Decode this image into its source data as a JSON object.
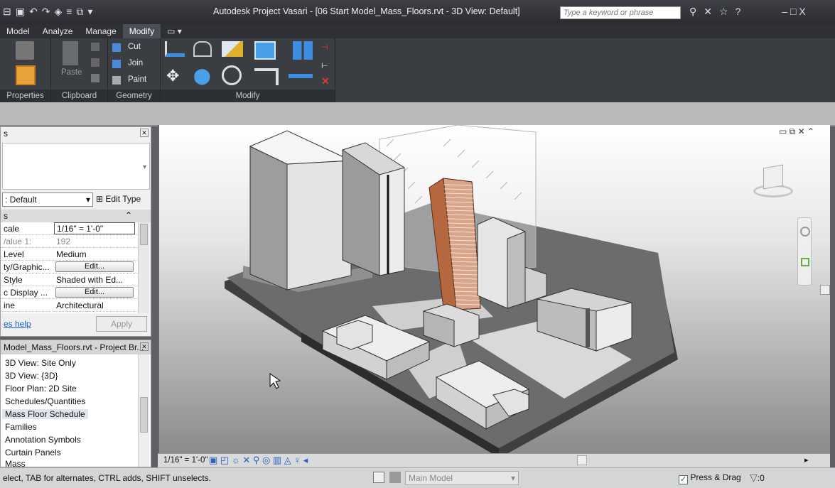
{
  "titlebar": {
    "title": "Autodesk Project Vasari - [06 Start Model_Mass_Floors.rvt - 3D View: Default]",
    "search_placeholder": "Type a keyword or phrase",
    "window_controls": "– □ X"
  },
  "ribbon_tabs": [
    "Model",
    "Analyze",
    "Manage",
    "Modify"
  ],
  "active_tab": "Modify",
  "ribbon": {
    "clipboard": {
      "paste": "Paste"
    },
    "geometry": {
      "cut": "Cut",
      "join": "Join",
      "paint": "Paint"
    },
    "panel_labels": {
      "properties": "Properties",
      "clipboard": "Clipboard",
      "geometry": "Geometry",
      "modify": "Modify"
    }
  },
  "properties": {
    "type_selector": ": Default",
    "edit_type": "Edit Type",
    "section_header": "s",
    "rows": [
      {
        "label": "cale",
        "value": "1/16\" = 1'-0\""
      },
      {
        "label": "/alue  1:",
        "value": "192"
      },
      {
        "label": "Level",
        "value": "Medium"
      },
      {
        "label": "ty/Graphic...",
        "value": "Edit..."
      },
      {
        "label": "Style",
        "value": "Shaded with Ed..."
      },
      {
        "label": "c Display ...",
        "value": "Edit..."
      },
      {
        "label": "ine",
        "value": "Architectural"
      }
    ],
    "help_link": "es help",
    "apply": "Apply"
  },
  "browser": {
    "header": "Model_Mass_Floors.rvt - Project Br...",
    "items": [
      "3D View: Site Only",
      "3D View: {3D}",
      "Floor Plan: 2D Site",
      "Schedules/Quantities",
      "Mass Floor Schedule",
      "Families",
      "Annotation Symbols",
      "Curtain Panels",
      "Mass"
    ]
  },
  "view_control": {
    "scale": "1/16\" = 1'-0\""
  },
  "status": {
    "message": "elect, TAB for alternates, CTRL adds, SHIFT unselects.",
    "workset": "Main Model",
    "press_drag": "Press & Drag",
    "filter_count": ":0"
  },
  "colors": {
    "ribbon_bg": "#3a3d42",
    "titlebar_bg": "#2e3035",
    "facade_accent": "#d9a58a"
  }
}
